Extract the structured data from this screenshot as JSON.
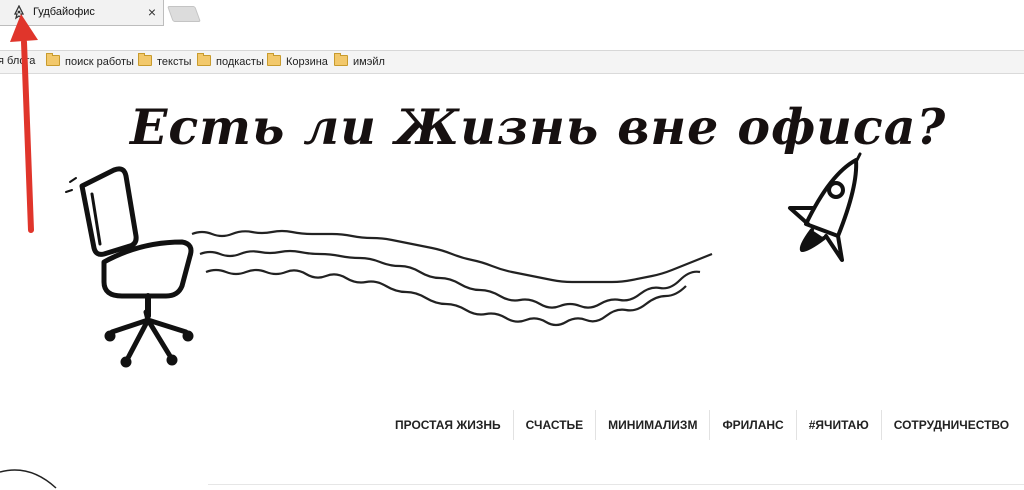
{
  "browser": {
    "tab": {
      "title": "Гудбайофис",
      "close_label": "×",
      "favicon_icon": "rocket-favicon-icon"
    },
    "new_tab_icon": "new-tab-icon"
  },
  "bookmarks": [
    {
      "label": "я блога",
      "icon": "none"
    },
    {
      "label": "поиск работы",
      "icon": "folder-icon"
    },
    {
      "label": "тексты",
      "icon": "folder-icon"
    },
    {
      "label": "подкасты",
      "icon": "folder-icon"
    },
    {
      "label": "Корзина",
      "icon": "folder-icon"
    },
    {
      "label": "имэйл",
      "icon": "folder-icon"
    }
  ],
  "hero": {
    "title": "Есть ли Жизнь вне офиса?",
    "illustration": [
      "office-chair-icon",
      "rocket-icon"
    ]
  },
  "nav": [
    "ПРОСТАЯ ЖИЗНЬ",
    "СЧАСТЬЕ",
    "МИНИМАЛИЗМ",
    "ФРИЛАНС",
    "#ЯЧИТАЮ",
    "СОТРУДНИЧЕСТВО"
  ],
  "annotation": {
    "arrow_color": "#e0352b"
  }
}
